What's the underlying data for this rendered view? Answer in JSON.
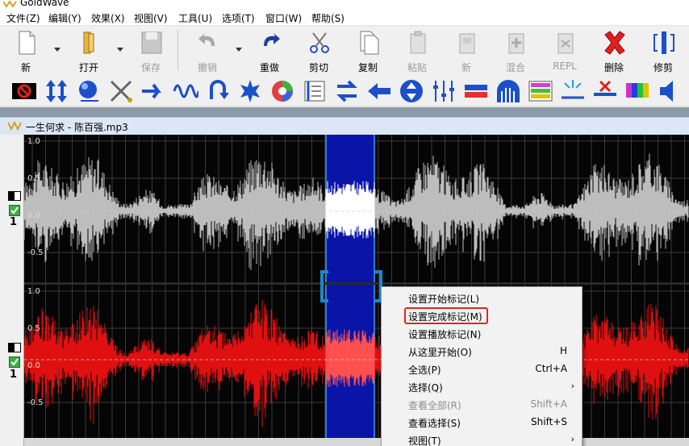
{
  "window": {
    "title": "GoldWave"
  },
  "menu": [
    "文件(Z)",
    "编辑(Y)",
    "效果(X)",
    "视图(V)",
    "工具(U)",
    "选项(T)",
    "窗口(W)",
    "帮助(S)"
  ],
  "toolbar": {
    "new": "新",
    "open": "打开",
    "save": "保存",
    "undo": "撤销",
    "redo": "重做",
    "cut": "剪切",
    "copy": "复制",
    "paste": "粘贴",
    "paste_new": "新",
    "mix": "混合",
    "repl": "REPL",
    "delete": "删除",
    "trim": "修剪"
  },
  "document": {
    "title": "一生何求 - 陈百强.mp3"
  },
  "channels": {
    "ch1_ticks": [
      "1.0",
      "0.5",
      "0.0",
      "-0.5"
    ],
    "ch2_ticks": [
      "1.0",
      "0.5",
      "0.0",
      "-0.5"
    ],
    "ch_number": "1"
  },
  "colors": {
    "ch1_wave": "#bdbdbd",
    "ch2_wave": "#e01010",
    "selection": "#0a14a8",
    "highlight": "#e0281c"
  },
  "context_menu": {
    "items": [
      {
        "label": "设置开始标记(L)",
        "shortcut": "",
        "submenu": false,
        "disabled": false
      },
      {
        "label": "设置完成标记(M)",
        "shortcut": "",
        "submenu": false,
        "disabled": false,
        "highlighted": true
      },
      {
        "label": "设置播放标记(N)",
        "shortcut": "",
        "submenu": false,
        "disabled": false
      },
      {
        "label": "从这里开始(O)",
        "shortcut": "H",
        "submenu": false,
        "disabled": false
      },
      {
        "label": "全选(P)",
        "shortcut": "Ctrl+A",
        "submenu": false,
        "disabled": false
      },
      {
        "label": "选择(Q)",
        "shortcut": "",
        "submenu": true,
        "disabled": false
      },
      {
        "label": "查看全部(R)",
        "shortcut": "Shift+A",
        "submenu": false,
        "disabled": true
      },
      {
        "label": "查看选择(S)",
        "shortcut": "Shift+S",
        "submenu": false,
        "disabled": false
      },
      {
        "label": "视图(T)",
        "shortcut": "",
        "submenu": true,
        "disabled": false
      }
    ]
  }
}
